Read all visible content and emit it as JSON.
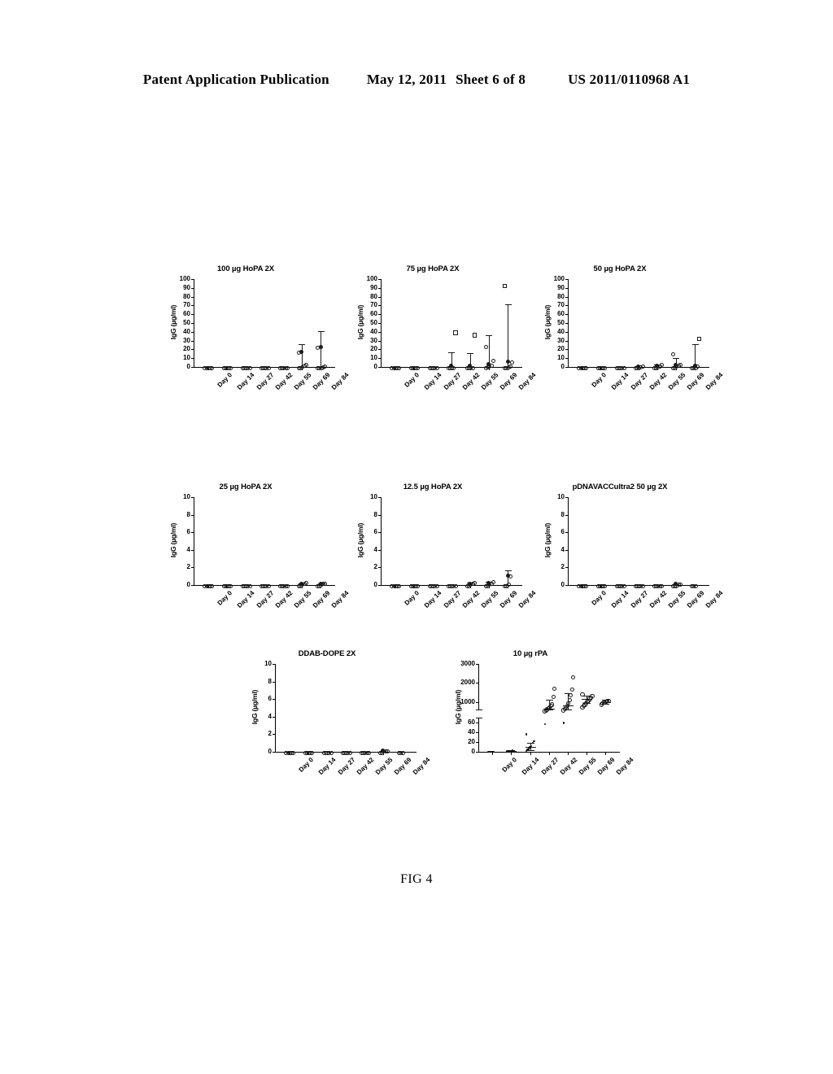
{
  "header": {
    "publication": "Patent Application Publication",
    "date": "May 12, 2011",
    "sheet": "Sheet 6 of 8",
    "patent_number": "US 2011/0110968 A1"
  },
  "figure": {
    "caption": "FIG 4"
  },
  "common": {
    "ylabel": "IgG  (µg/ml)",
    "x_categories": [
      "Day 0",
      "Day 14",
      "Day 27",
      "Day 42",
      "Day 55",
      "Day 69",
      "Day 84"
    ]
  },
  "chart_data": [
    {
      "id": "chart-100ug-hopa-2x",
      "type": "scatter",
      "title": "100 µg HoPA 2X",
      "xlabel": "",
      "ylabel": "IgG  (µg/ml)",
      "ylim": [
        0,
        100
      ],
      "yticks": [
        0,
        10,
        20,
        30,
        40,
        50,
        60,
        70,
        80,
        90,
        100
      ],
      "ytick_labels": [
        "0",
        "10",
        "20",
        "30",
        "40",
        "50",
        "60",
        "70",
        "80",
        "90",
        "100"
      ],
      "categories": [
        "Day 0",
        "Day 14",
        "Day 27",
        "Day 42",
        "Day 55",
        "Day 69",
        "Day 84"
      ],
      "grid": false,
      "legend": "none",
      "series": [
        {
          "name": "mean",
          "values": [
            0,
            0,
            0,
            0,
            0,
            17,
            23
          ],
          "err_upper": [
            0,
            0,
            0,
            0,
            0,
            26,
            40.5
          ],
          "err_lower": [
            0,
            0,
            0,
            0,
            0,
            0,
            0
          ]
        }
      ],
      "points": {
        "Day 0": [
          0,
          0,
          0,
          0,
          0
        ],
        "Day 14": [
          0,
          0,
          0,
          0,
          0
        ],
        "Day 27": [
          0,
          0,
          0,
          0,
          0
        ],
        "Day 42": [
          0,
          0,
          0,
          0,
          0
        ],
        "Day 55": [
          0,
          0,
          0,
          0,
          0
        ],
        "Day 69": [
          0,
          0,
          0.5,
          2,
          3.5,
          17
        ],
        "Day 84": [
          0,
          0,
          0,
          0.5,
          1,
          23
        ]
      }
    },
    {
      "id": "chart-75ug-hopa-2x",
      "type": "scatter",
      "title": "75 µg HoPA 2X",
      "xlabel": "",
      "ylabel": "IgG  (µg/ml)",
      "ylim": [
        0,
        100
      ],
      "yticks": [
        0,
        10,
        20,
        30,
        40,
        50,
        60,
        70,
        80,
        90,
        100
      ],
      "ytick_labels": [
        "0",
        "10",
        "20",
        "30",
        "40",
        "50",
        "60",
        "70",
        "80",
        "90",
        "100"
      ],
      "categories": [
        "Day 0",
        "Day 14",
        "Day 27",
        "Day 42",
        "Day 55",
        "Day 69",
        "Day 84"
      ],
      "grid": false,
      "legend": "none",
      "series": [
        {
          "name": "mean",
          "values": [
            0,
            0,
            0,
            1,
            1,
            3,
            6
          ],
          "err_upper": [
            0,
            0,
            0,
            16.5,
            15.5,
            36.5,
            71
          ],
          "err_lower": [
            0,
            0,
            0,
            0,
            0,
            0,
            0
          ]
        }
      ],
      "points": {
        "Day 0": [
          0,
          0,
          0,
          0,
          0
        ],
        "Day 14": [
          0,
          0,
          0,
          0,
          0
        ],
        "Day 27": [
          0,
          0,
          0,
          0,
          0
        ],
        "Day 42": [
          0,
          0,
          0,
          0,
          40
        ],
        "Day 55": [
          0,
          0,
          0,
          0,
          37
        ],
        "Day 69": [
          0,
          0.5,
          1,
          2,
          7.5,
          24
        ],
        "Day 84": [
          0,
          0,
          0.5,
          1,
          6,
          93
        ]
      }
    },
    {
      "id": "chart-50ug-hopa-2x",
      "type": "scatter",
      "title": "50 µg HoPA 2X",
      "xlabel": "",
      "ylabel": "IgG  (µg/ml)",
      "ylim": [
        0,
        100
      ],
      "yticks": [
        0,
        10,
        20,
        30,
        40,
        50,
        60,
        70,
        80,
        90,
        100
      ],
      "ytick_labels": [
        "0",
        "10",
        "20",
        "30",
        "40",
        "50",
        "60",
        "70",
        "80",
        "90",
        "100"
      ],
      "categories": [
        "Day 0",
        "Day 14",
        "Day 27",
        "Day 42",
        "Day 55",
        "Day 69",
        "Day 84"
      ],
      "grid": false,
      "legend": "none",
      "series": [
        {
          "name": "mean",
          "values": [
            0,
            0,
            0,
            0.5,
            1,
            2.5,
            1
          ],
          "err_upper": [
            0,
            0,
            0,
            0,
            2.5,
            10.5,
            26
          ],
          "err_lower": [
            0,
            0,
            0,
            0,
            0,
            0,
            0
          ]
        }
      ],
      "points": {
        "Day 0": [
          0,
          0,
          0,
          0,
          0
        ],
        "Day 14": [
          0,
          0,
          0,
          0,
          0
        ],
        "Day 27": [
          0,
          0,
          0,
          0,
          0
        ],
        "Day 42": [
          0,
          0,
          0,
          0.5,
          1
        ],
        "Day 55": [
          0,
          0,
          0.5,
          1,
          3
        ],
        "Day 69": [
          0,
          0,
          1,
          2,
          3,
          15
        ],
        "Day 84": [
          0,
          0,
          0,
          1,
          33
        ]
      }
    },
    {
      "id": "chart-25ug-hopa-2x",
      "type": "scatter",
      "title": "25 µg HoPA 2X",
      "xlabel": "",
      "ylabel": "IgG  (µg/ml)",
      "ylim": [
        0,
        10
      ],
      "yticks": [
        0,
        2,
        4,
        6,
        8,
        10
      ],
      "ytick_labels": [
        "0",
        "2",
        "4",
        "6",
        "8",
        "10"
      ],
      "categories": [
        "Day 0",
        "Day 14",
        "Day 27",
        "Day 42",
        "Day 55",
        "Day 69",
        "Day 84"
      ],
      "grid": false,
      "legend": "none",
      "series": [
        {
          "name": "mean",
          "values": [
            0,
            0,
            0,
            0,
            0,
            0.1,
            0.1
          ],
          "err_upper": [
            0,
            0,
            0,
            0,
            0,
            0.2,
            0.2
          ],
          "err_lower": [
            0,
            0,
            0,
            0,
            0,
            0,
            0
          ]
        }
      ],
      "points": {
        "Day 0": [
          0,
          0,
          0,
          0,
          0
        ],
        "Day 14": [
          0,
          0,
          0,
          0,
          0
        ],
        "Day 27": [
          0,
          0,
          0,
          0,
          0
        ],
        "Day 42": [
          0,
          0,
          0,
          0,
          0
        ],
        "Day 55": [
          0,
          0,
          0,
          0,
          0
        ],
        "Day 69": [
          0,
          0,
          0.1,
          0.2,
          0.3
        ],
        "Day 84": [
          0,
          0,
          0.1,
          0.2,
          0.2
        ]
      }
    },
    {
      "id": "chart-12-5ug-hopa-2x",
      "type": "scatter",
      "title": "12.5 µg HoPA 2X",
      "xlabel": "",
      "ylabel": "IgG  (µg/ml)",
      "ylim": [
        0,
        10
      ],
      "yticks": [
        0,
        2,
        4,
        6,
        8,
        10
      ],
      "ytick_labels": [
        "0",
        "2",
        "4",
        "6",
        "8",
        "10"
      ],
      "categories": [
        "Day 0",
        "Day 14",
        "Day 27",
        "Day 42",
        "Day 55",
        "Day 69",
        "Day 84"
      ],
      "grid": false,
      "legend": "none",
      "series": [
        {
          "name": "mean",
          "values": [
            0,
            0,
            0,
            0,
            0.1,
            0.2,
            1.1
          ],
          "err_upper": [
            0,
            0,
            0,
            0,
            0.3,
            0.4,
            1.7
          ],
          "err_lower": [
            0,
            0,
            0,
            0,
            0,
            0,
            0
          ]
        }
      ],
      "points": {
        "Day 0": [
          0,
          0,
          0,
          0,
          0
        ],
        "Day 14": [
          0,
          0,
          0,
          0,
          0
        ],
        "Day 27": [
          0,
          0,
          0,
          0,
          0
        ],
        "Day 42": [
          0,
          0,
          0,
          0,
          0
        ],
        "Day 55": [
          0,
          0,
          0.1,
          0.2,
          0.3
        ],
        "Day 69": [
          0,
          0,
          0.1,
          0.2,
          0.4
        ],
        "Day 84": [
          0,
          0,
          0.1,
          1.1
        ]
      }
    },
    {
      "id": "chart-pdnavaccultra2-50ug-2x",
      "type": "scatter",
      "title": "pDNAVACCultra2 50 µg 2X",
      "xlabel": "",
      "ylabel": "IgG  (µg/ml)",
      "ylim": [
        0,
        10
      ],
      "yticks": [
        0,
        2,
        4,
        6,
        8,
        10
      ],
      "ytick_labels": [
        "0",
        "2",
        "4",
        "6",
        "8",
        "10"
      ],
      "categories": [
        "Day 0",
        "Day 14",
        "Day 27",
        "Day 42",
        "Day 55",
        "Day 69",
        "Day 84"
      ],
      "grid": false,
      "legend": "none",
      "series": [
        {
          "name": "mean",
          "values": [
            0,
            0,
            0,
            0,
            0,
            0.1,
            0
          ],
          "err_upper": [
            0,
            0,
            0,
            0,
            0,
            0.1,
            0
          ],
          "err_lower": [
            0,
            0,
            0,
            0,
            0,
            0,
            0
          ]
        }
      ],
      "points": {
        "Day 0": [
          0,
          0,
          0,
          0,
          0
        ],
        "Day 14": [
          0,
          0,
          0,
          0,
          0
        ],
        "Day 27": [
          0,
          0,
          0,
          0,
          0
        ],
        "Day 42": [
          0,
          0,
          0,
          0,
          0
        ],
        "Day 55": [
          0,
          0,
          0,
          0,
          0
        ],
        "Day 69": [
          0,
          0,
          0,
          0.1,
          0.1
        ],
        "Day 84": [
          0,
          0,
          0
        ]
      }
    },
    {
      "id": "chart-ddab-dope-2x",
      "type": "scatter",
      "title": "DDAB-DOPE 2X",
      "xlabel": "",
      "ylabel": "IgG  (µg/ml)",
      "ylim": [
        0,
        10
      ],
      "yticks": [
        0,
        2,
        4,
        6,
        8,
        10
      ],
      "ytick_labels": [
        "0",
        "2",
        "4",
        "6",
        "8",
        "10"
      ],
      "categories": [
        "Day 0",
        "Day 14",
        "Day 27",
        "Day 42",
        "Day 55",
        "Day 69",
        "Day 84"
      ],
      "grid": false,
      "legend": "none",
      "series": [
        {
          "name": "mean",
          "values": [
            0,
            0,
            0,
            0,
            0,
            0.1,
            0
          ],
          "err_upper": [
            0,
            0,
            0,
            0,
            0,
            0.1,
            0
          ],
          "err_lower": [
            0,
            0,
            0,
            0,
            0,
            0,
            0
          ]
        }
      ],
      "points": {
        "Day 0": [
          0,
          0,
          0,
          0,
          0
        ],
        "Day 14": [
          0,
          0,
          0,
          0,
          0
        ],
        "Day 27": [
          0,
          0,
          0,
          0,
          0
        ],
        "Day 42": [
          0,
          0,
          0,
          0,
          0
        ],
        "Day 55": [
          0,
          0,
          0,
          0,
          0
        ],
        "Day 69": [
          0,
          0,
          0.1,
          0.1,
          0.1
        ],
        "Day 84": [
          0,
          0,
          0
        ]
      }
    },
    {
      "id": "chart-10ug-rpa",
      "type": "scatter",
      "title": "10 µg rPA",
      "xlabel": "",
      "ylabel": "IgG  (µg/ml)",
      "broken_axis": true,
      "ylim_upper": [
        600,
        3000
      ],
      "yticks_upper": [
        1000,
        2000,
        3000
      ],
      "ytick_labels_upper": [
        "1000",
        "2000",
        "3000"
      ],
      "ylim_lower": [
        0,
        70
      ],
      "yticks_lower": [
        0,
        20,
        40,
        60
      ],
      "ytick_labels_lower": [
        "0",
        "20",
        "40",
        "60"
      ],
      "categories": [
        "Day 0",
        "Day 14",
        "Day 27",
        "Day 42",
        "Day 55",
        "Day 69",
        "Day 84"
      ],
      "grid": false,
      "legend": "none",
      "series": [
        {
          "name": "mean",
          "values": [
            0,
            1,
            10,
            650,
            800,
            1150,
            1000
          ],
          "err_upper": [
            0,
            3,
            19,
            1100,
            1450,
            1350,
            1120
          ],
          "err_lower": [
            0,
            0,
            4,
            420,
            380,
            950,
            900
          ]
        }
      ],
      "points_upper": {
        "Day 42": [
          560,
          600,
          640,
          700,
          760,
          820,
          900,
          1300,
          1750
        ],
        "Day 55": [
          600,
          680,
          760,
          840,
          980,
          1150,
          1400,
          1700,
          2350
        ],
        "Day 69": [
          760,
          820,
          900,
          980,
          1050,
          1100,
          1200,
          1280,
          1350,
          1450
        ],
        "Day 84": [
          900,
          950,
          1000,
          1020,
          1050,
          1080,
          1100
        ]
      },
      "points_lower": {
        "Day 0": [
          0,
          0,
          0,
          0,
          0
        ],
        "Day 14": [
          0.5,
          1,
          1.5,
          2,
          2.5
        ],
        "Day 27": [
          2,
          4,
          6,
          9,
          12,
          18,
          22,
          36
        ],
        "Day 42": [
          57
        ],
        "Day 55": [
          59
        ]
      }
    }
  ]
}
